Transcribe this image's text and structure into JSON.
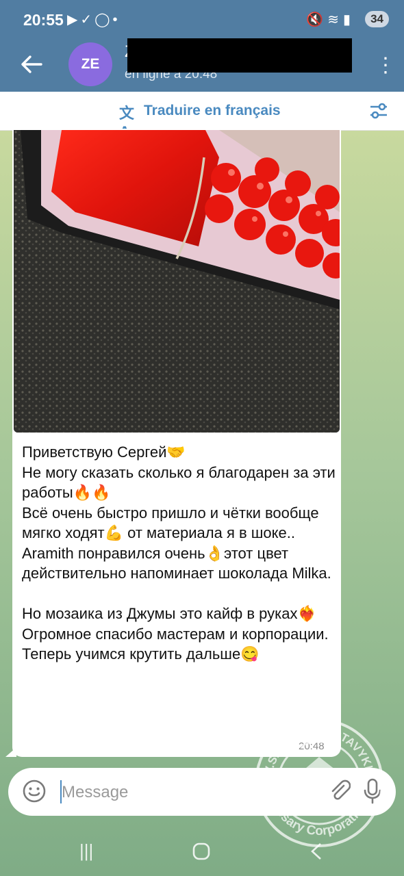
{
  "status_bar": {
    "time": "20:55",
    "left_icons": [
      "youtube-icon",
      "download-icon",
      "whatsapp-icon",
      "dot-icon"
    ],
    "right_icons": [
      "mute-icon",
      "wifi-icon",
      "signal-icon"
    ],
    "battery": "34"
  },
  "header": {
    "avatar_initials": "ZE",
    "name": "Z",
    "status": "en ligne à 20:48"
  },
  "translate_bar": {
    "label": "Traduire en français"
  },
  "message": {
    "text": "Приветствую Сергей🤝\nНе могу сказать сколько я благодарен за эти работы🔥🔥\nВсё очень быстро пришло и чётки вообще мягко ходят💪 от материала я в шоке..\nAramith понравился очень👌этот цвет действительно напоминает шоколада Milka.\n\nНо мозаика из Джумы это кайф в руках❤️‍🔥\nОгромное спасибо мастерам и корпорации.\nТеперь учимся крутить дальше😋",
    "time": "20:48"
  },
  "input": {
    "placeholder": "Message"
  },
  "watermark": {
    "top_text": "V.S.-BAGA-KARTAVYKH",
    "bottom_text": "Rosary Corporation"
  },
  "colors": {
    "header": "#517da2",
    "accent": "#4a8ac0",
    "bubble": "#ffffff",
    "avatar": "#8a6bdf"
  }
}
